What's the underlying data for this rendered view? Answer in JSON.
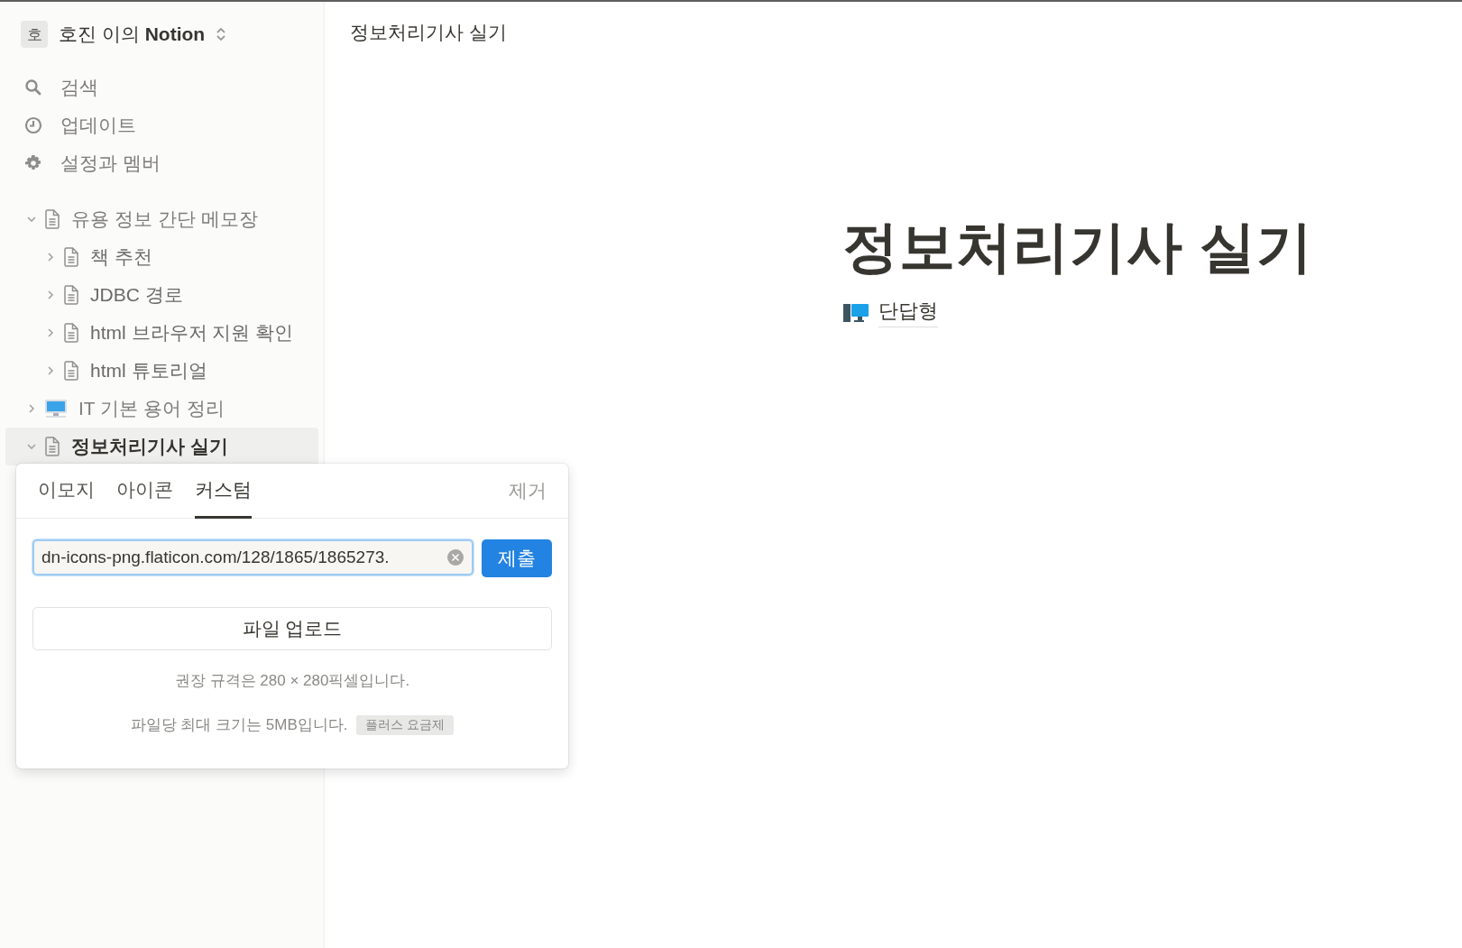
{
  "workspace": {
    "avatar": "호",
    "name": "호진 이의 **Notion**"
  },
  "nav": [
    {
      "kind": "search",
      "label": "검색"
    },
    {
      "kind": "updates",
      "label": "업데이트"
    },
    {
      "kind": "settings",
      "label": "설정과 멤버"
    }
  ],
  "tree": [
    {
      "label": "유용 정보 간단 메모장",
      "kind": "page",
      "expanded": true,
      "selected": false,
      "children": [
        {
          "label": "책 추천",
          "kind": "page",
          "expanded": false,
          "selected": false
        },
        {
          "label": "JDBC 경로",
          "kind": "page",
          "expanded": false,
          "selected": false
        },
        {
          "label": "html 브라우저 지원 확인",
          "kind": "page",
          "expanded": false,
          "selected": false
        },
        {
          "label": "html 튜토리얼",
          "kind": "page",
          "expanded": false,
          "selected": false
        }
      ]
    },
    {
      "label": "IT 기본 용어 정리",
      "kind": "computer",
      "expanded": false,
      "selected": false
    },
    {
      "label": "정보처리기사 실기",
      "kind": "page",
      "expanded": true,
      "selected": true
    }
  ],
  "popup": {
    "tabs": [
      {
        "label": "이모지",
        "selected": false
      },
      {
        "label": "아이콘",
        "selected": false
      },
      {
        "label": "커스텀",
        "selected": true
      }
    ],
    "remove": "제거",
    "url": "dn-icons-png.flaticon.com/128/1865/1865273.",
    "submit": "제출",
    "upload": "파일 업로드",
    "hint": "권장 규격은 280 × 280픽셀입니다.",
    "limit": "파일당 최대 크기는 5MB입니다.",
    "badge": "플러스 요금제"
  },
  "page": {
    "breadcrumb": "정보처리기사 실기",
    "title": "정보처리기사 실기",
    "subpages": [
      {
        "label": "단답형"
      }
    ]
  }
}
